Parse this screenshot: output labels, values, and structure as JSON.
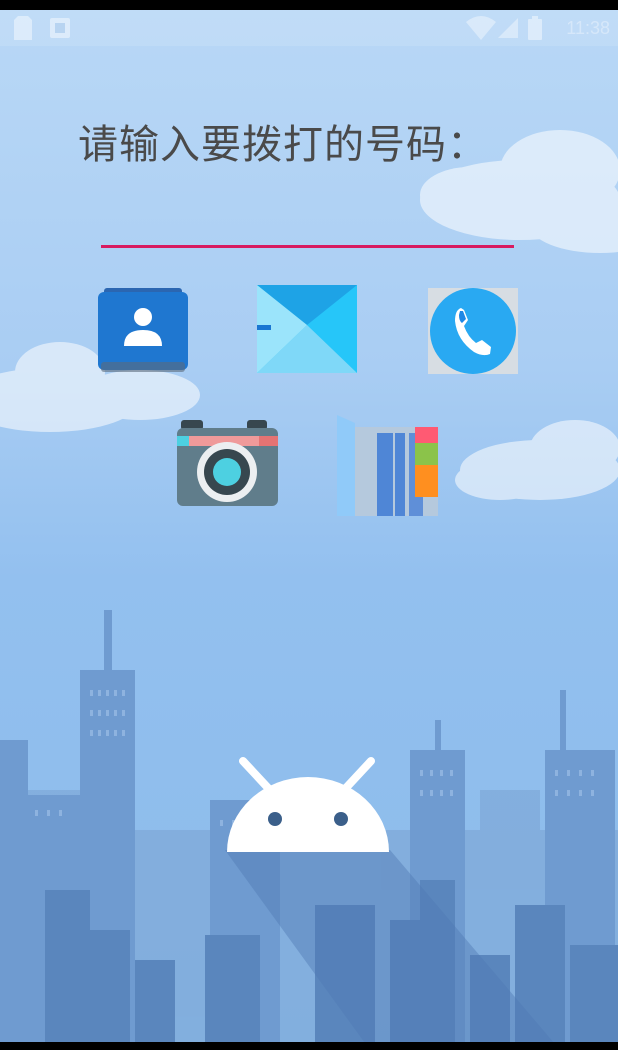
{
  "status_bar": {
    "time": "11:38",
    "left_icons": [
      "sim-card-icon",
      "notification-icon"
    ],
    "right_icons": [
      "wifi-icon",
      "signal-icon",
      "battery-icon"
    ]
  },
  "dialer": {
    "prompt_label": "请输入要拨打的号码：",
    "number_value": "",
    "placeholder": "",
    "underline_color": "#d81b60"
  },
  "apps": [
    {
      "icon": "contacts-icon",
      "color": "#1976d2"
    },
    {
      "icon": "messages-icon",
      "color": "#29b6f6"
    },
    {
      "icon": "phone-icon",
      "color": "#29a9f2"
    },
    {
      "icon": "camera-icon",
      "color": "#607d8b"
    },
    {
      "icon": "book-icon",
      "color": "#90caf9"
    }
  ],
  "theme": {
    "sky_top": "#b9d8f6",
    "sky_bottom": "#8bbbea",
    "city_color": "#5a86bd",
    "android_logo": "#ffffff"
  }
}
